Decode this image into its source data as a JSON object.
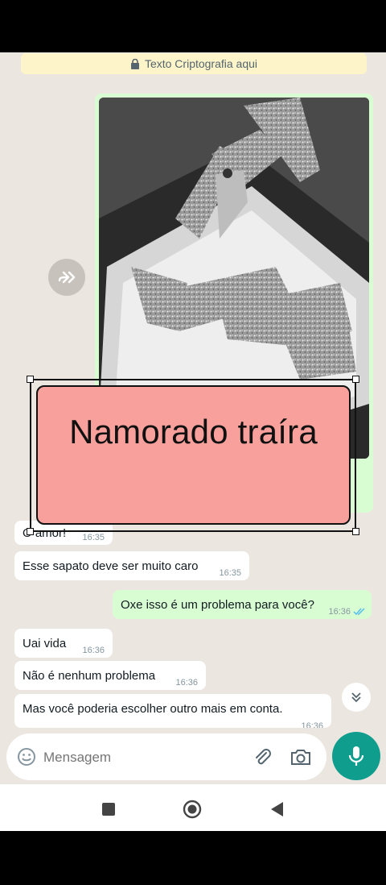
{
  "encryption_banner": {
    "text": "Texto Criptografia aqui",
    "icon": "lock-icon"
  },
  "overlay": {
    "text": "Namorado traíra",
    "background": "#f8a19c"
  },
  "messages": [
    {
      "direction": "in",
      "text": "O amor!",
      "time": "16:35"
    },
    {
      "direction": "in",
      "text": "Esse sapato deve ser muito caro",
      "time": "16:35"
    },
    {
      "direction": "out",
      "text": "Oxe isso é um problema para você?",
      "time": "16:36"
    },
    {
      "direction": "in",
      "text": "Uai vida",
      "time": "16:36"
    },
    {
      "direction": "in",
      "text": "Não é nenhum problema",
      "time": "16:36"
    },
    {
      "direction": "in",
      "text": "Mas você poderia escolher outro mais em conta.",
      "time": "16:36"
    }
  ],
  "composer": {
    "placeholder": "Mensagem"
  },
  "colors": {
    "accent": "#0f9e8e",
    "outgoing_bubble": "#d9fdd3",
    "read_ticks": "#53bdeb"
  }
}
